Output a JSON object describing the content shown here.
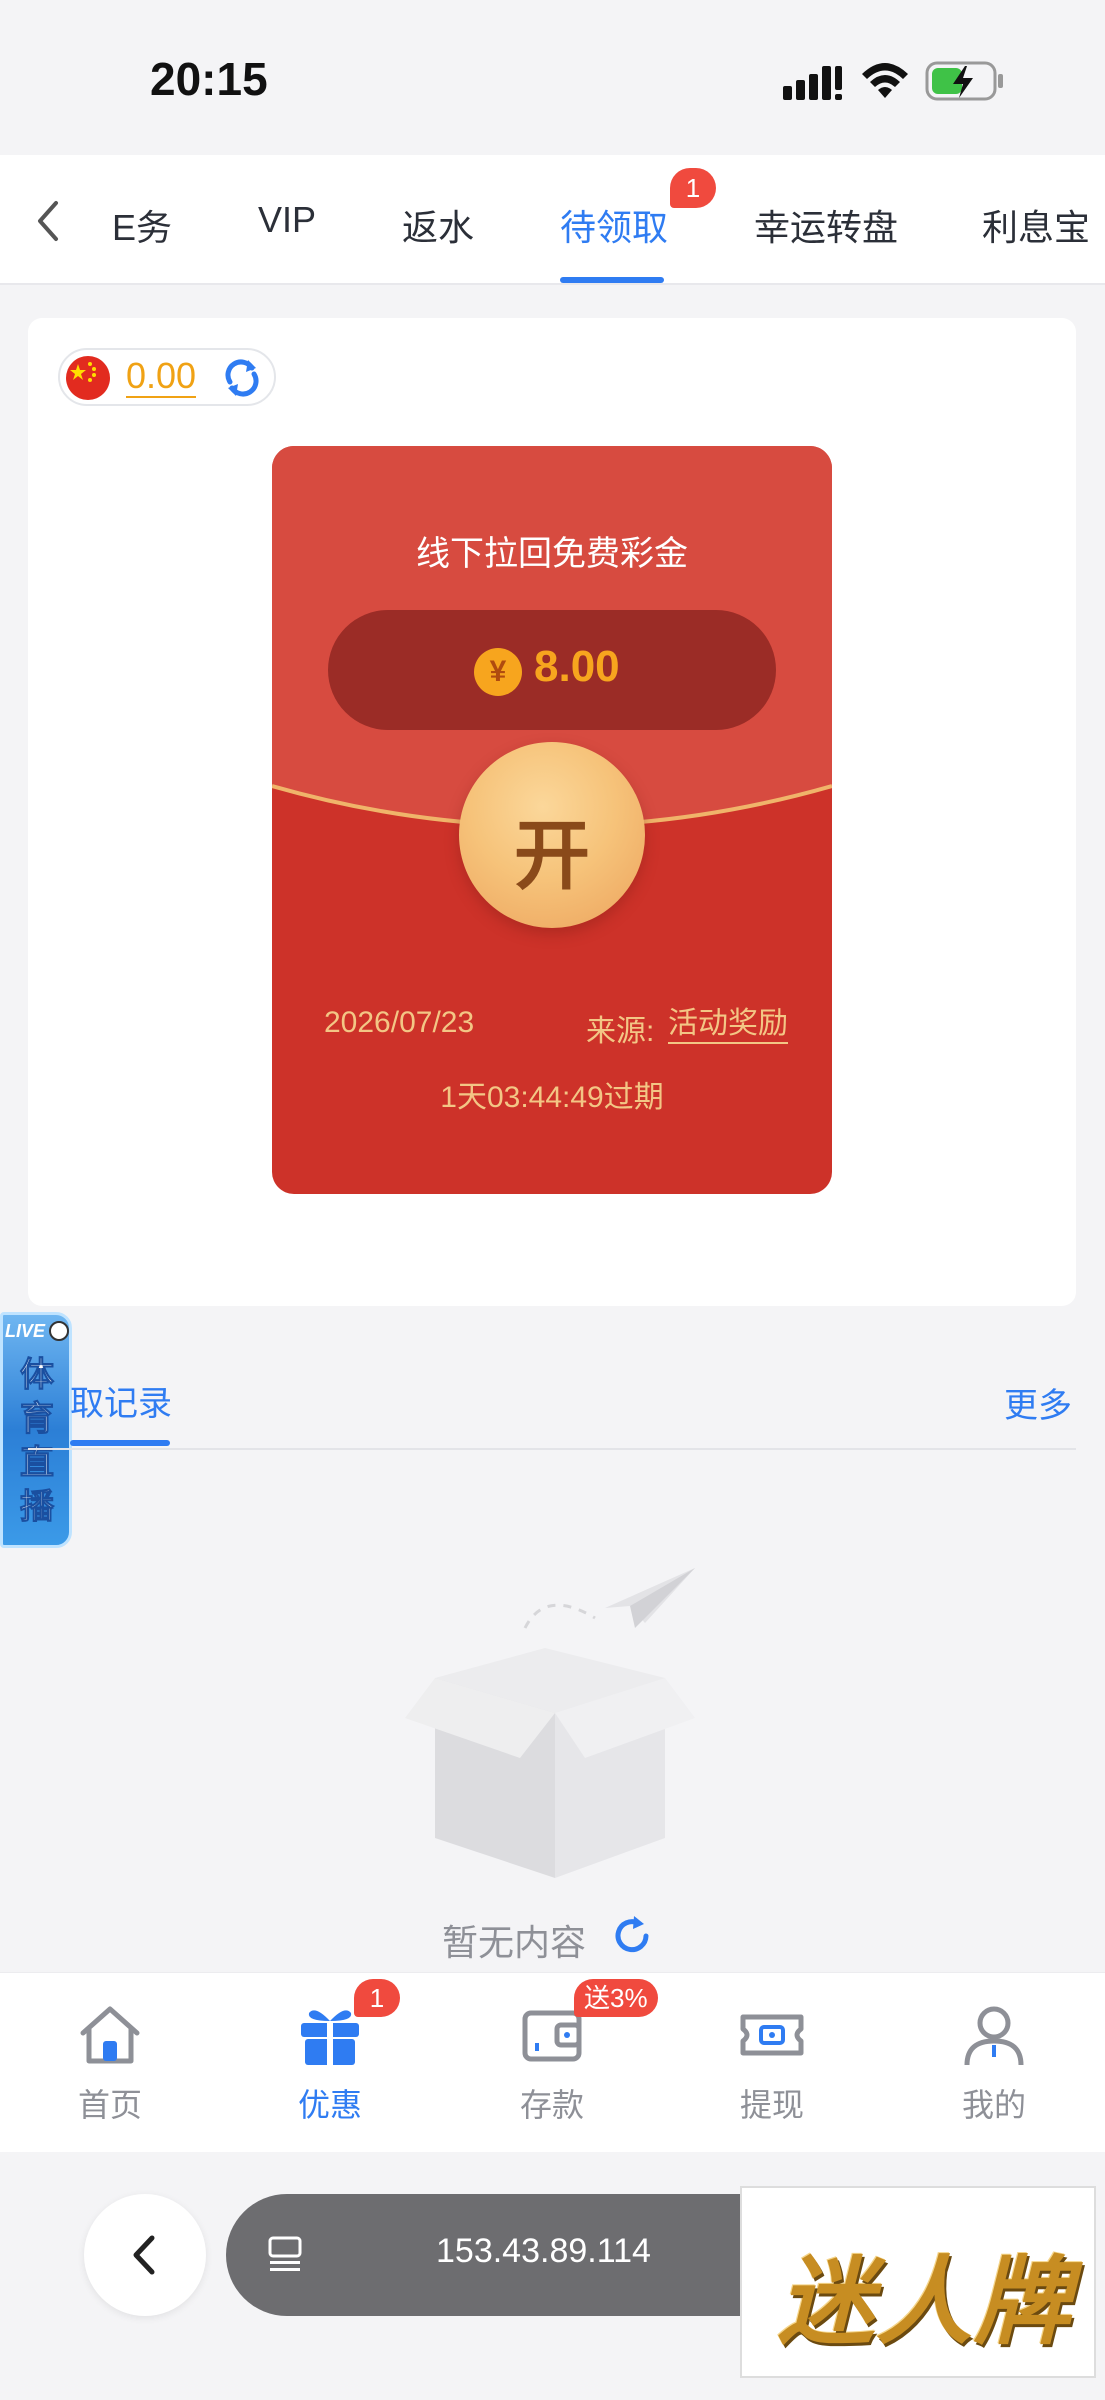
{
  "status_bar": {
    "time": "20:15"
  },
  "tabs": {
    "items": [
      "E务",
      "VIP",
      "返水",
      "待领取",
      "幸运转盘",
      "利息宝"
    ],
    "active_index": 3,
    "badge": "1"
  },
  "balance": {
    "amount": "0.00"
  },
  "envelope": {
    "title": "线下拉回免费彩金",
    "currency_symbol": "¥",
    "amount": "8.00",
    "open_label": "开",
    "date": "2026/07/23",
    "source_label": "来源:",
    "source_value": "活动奖励",
    "expire_text": "1天03:44:49过期"
  },
  "live_widget": {
    "tag": "LIVE",
    "text": "体育直播"
  },
  "records": {
    "title": "取记录",
    "more": "更多"
  },
  "empty_state": {
    "text": "暂无内容"
  },
  "bottom_nav": {
    "items": [
      {
        "label": "首页"
      },
      {
        "label": "优惠",
        "badge": "1"
      },
      {
        "label": "存款",
        "badge": "送3%"
      },
      {
        "label": "提现"
      },
      {
        "label": "我的"
      }
    ],
    "active_index": 1
  },
  "browser": {
    "url": "153.43.89.114"
  },
  "ad": {
    "text": "迷人牌"
  },
  "colors": {
    "accent": "#2f7cf2",
    "envelope_red": "#cd3229",
    "gold": "#f7a51e",
    "badge_red": "#f04a3e"
  }
}
